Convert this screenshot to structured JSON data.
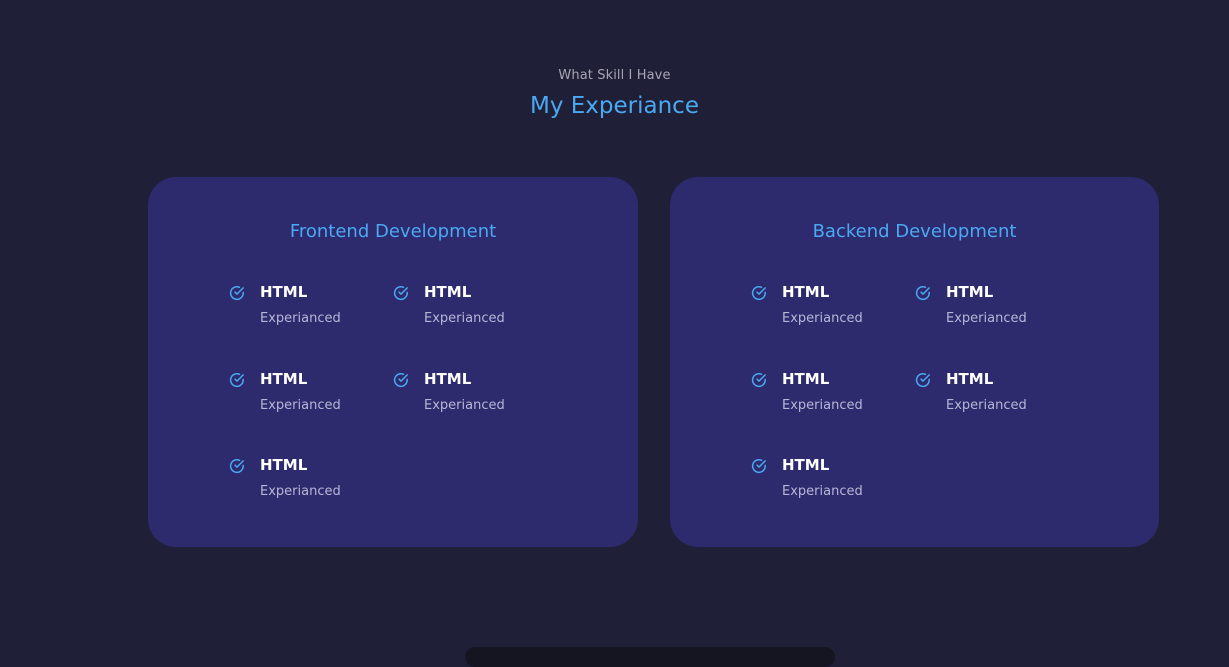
{
  "section": {
    "subtitle": "What Skill I Have",
    "title": "My Experiance"
  },
  "colors": {
    "background": "#1f1f37",
    "card": "#2d2a6d",
    "accent": "#4aa9f2",
    "muted": "#a6a6b3"
  },
  "frontend": {
    "title": "Frontend Development",
    "skills": [
      {
        "name": "HTML",
        "level": "Experianced",
        "icon": "check-circle-icon"
      },
      {
        "name": "HTML",
        "level": "Experianced",
        "icon": "check-circle-icon"
      },
      {
        "name": "HTML",
        "level": "Experianced",
        "icon": "check-circle-icon"
      },
      {
        "name": "HTML",
        "level": "Experianced",
        "icon": "check-circle-icon"
      },
      {
        "name": "HTML",
        "level": "Experianced",
        "icon": "check-circle-icon"
      }
    ]
  },
  "backend": {
    "title": "Backend Development",
    "skills": [
      {
        "name": "HTML",
        "level": "Experianced",
        "icon": "check-circle-icon"
      },
      {
        "name": "HTML",
        "level": "Experianced",
        "icon": "check-circle-icon"
      },
      {
        "name": "HTML",
        "level": "Experianced",
        "icon": "check-circle-icon"
      },
      {
        "name": "HTML",
        "level": "Experianced",
        "icon": "check-circle-icon"
      },
      {
        "name": "HTML",
        "level": "Experianced",
        "icon": "check-circle-icon"
      }
    ]
  }
}
